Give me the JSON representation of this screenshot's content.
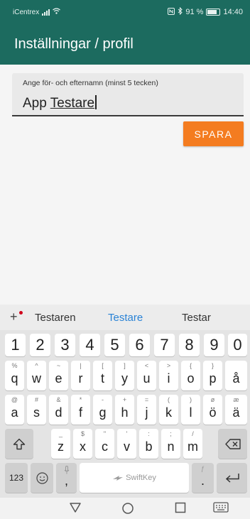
{
  "status_bar": {
    "carrier": "iCentrex",
    "battery_percent": "91 %",
    "time": "14:40",
    "icons": [
      "signal-icon",
      "wifi-icon",
      "nfc-icon",
      "bluetooth-icon",
      "battery-icon"
    ]
  },
  "app_bar": {
    "title": "Inställningar / profil"
  },
  "name_field": {
    "label": "Ange för- och efternamn (minst 5 tecken)",
    "value_first": "App",
    "value_last": "Testare"
  },
  "save_button": {
    "label": "SPARA"
  },
  "keyboard": {
    "suggestions": [
      "Testaren",
      "Testare",
      "Testar"
    ],
    "numbers": [
      "1",
      "2",
      "3",
      "4",
      "5",
      "6",
      "7",
      "8",
      "9",
      "0"
    ],
    "row1": [
      {
        "key": "q",
        "hint": "%"
      },
      {
        "key": "w",
        "hint": "^"
      },
      {
        "key": "e",
        "hint": "~"
      },
      {
        "key": "r",
        "hint": "|"
      },
      {
        "key": "t",
        "hint": "["
      },
      {
        "key": "y",
        "hint": "]"
      },
      {
        "key": "u",
        "hint": "<"
      },
      {
        "key": "i",
        "hint": ">"
      },
      {
        "key": "o",
        "hint": "{"
      },
      {
        "key": "p",
        "hint": "}"
      },
      {
        "key": "å",
        "hint": ""
      }
    ],
    "row2": [
      {
        "key": "a",
        "hint": "@"
      },
      {
        "key": "s",
        "hint": "#"
      },
      {
        "key": "d",
        "hint": "&"
      },
      {
        "key": "f",
        "hint": "*"
      },
      {
        "key": "g",
        "hint": "-"
      },
      {
        "key": "h",
        "hint": "+"
      },
      {
        "key": "j",
        "hint": "="
      },
      {
        "key": "k",
        "hint": "("
      },
      {
        "key": "l",
        "hint": ")"
      },
      {
        "key": "ö",
        "hint": "ø"
      },
      {
        "key": "ä",
        "hint": "æ"
      }
    ],
    "row3": [
      {
        "key": "z",
        "hint": "_"
      },
      {
        "key": "x",
        "hint": "$"
      },
      {
        "key": "c",
        "hint": "\""
      },
      {
        "key": "v",
        "hint": "'"
      },
      {
        "key": "b",
        "hint": ":"
      },
      {
        "key": "n",
        "hint": ";"
      },
      {
        "key": "m",
        "hint": "/"
      }
    ],
    "numbers_toggle": "123",
    "comma": ",",
    "period": ".",
    "space_label": "SwiftKey"
  }
}
